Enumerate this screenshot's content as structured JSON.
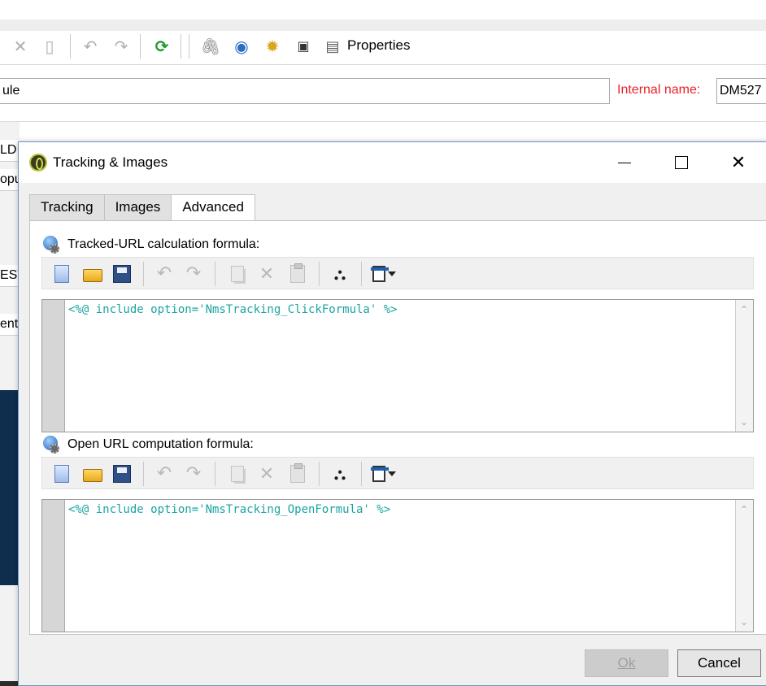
{
  "background": {
    "toolbar": {
      "properties_label": "Properties"
    },
    "label_field_value": "ule",
    "internal_name_label": "Internal name:",
    "internal_name_value": "DM527",
    "left_fragments": [
      "LDI",
      "opu",
      "EST",
      "ent"
    ]
  },
  "dialog": {
    "title": "Tracking & Images",
    "tabs": [
      "Tracking",
      "Images",
      "Advanced"
    ],
    "active_tab": "Advanced",
    "sections": [
      {
        "label": "Tracked-URL calculation formula:",
        "code": "<%@ include option='NmsTracking_ClickFormula' %>"
      },
      {
        "label": "Open URL computation formula:",
        "code": "<%@ include option='NmsTracking_OpenFormula' %>"
      }
    ],
    "buttons": {
      "ok": "Ok",
      "cancel": "Cancel"
    },
    "colors": {
      "code_text": "#1aa5a0",
      "internal_name_label": "#e8232a",
      "window_border": "#6c96c8"
    }
  }
}
